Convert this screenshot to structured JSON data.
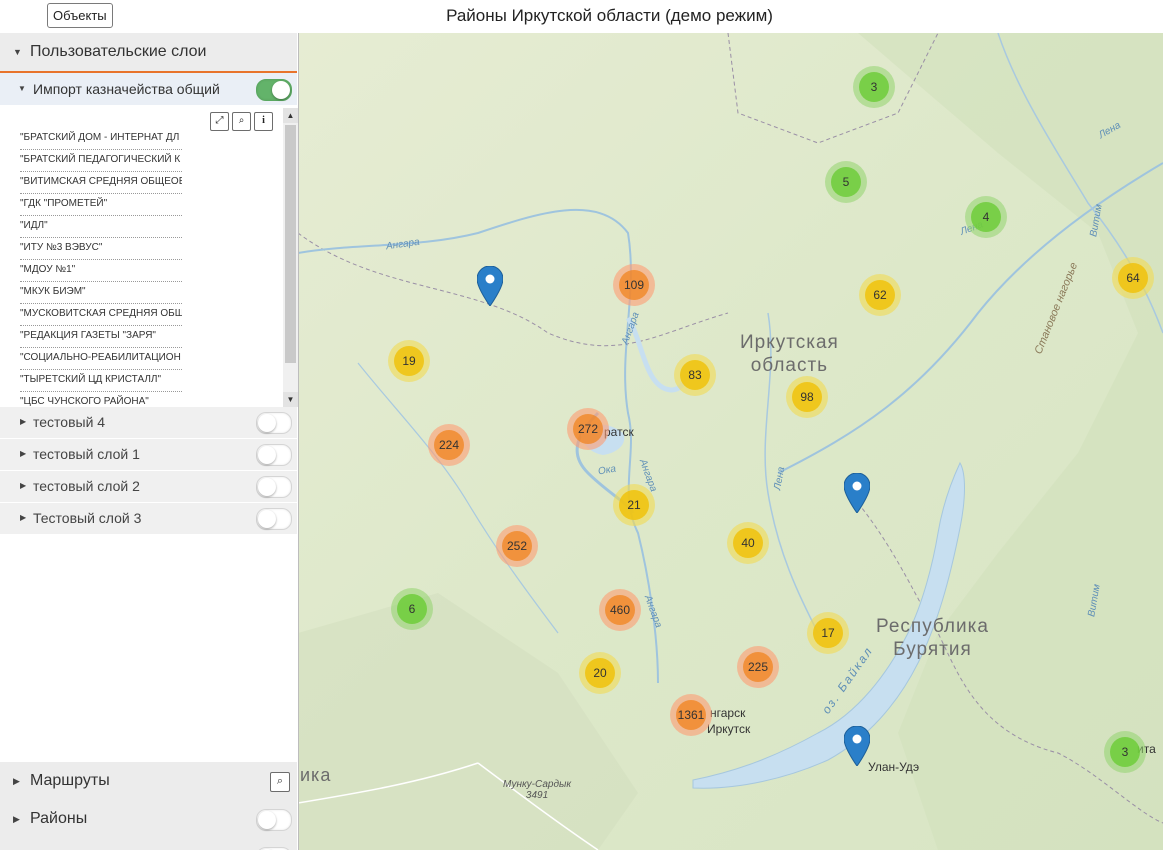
{
  "header": {
    "objects_button": "Объекты",
    "title": "Районы Иркутской области (демо режим)"
  },
  "sidebar": {
    "user_layers_title": "Пользовательские слои",
    "import_layer": {
      "label": "Импорт казначейства общий",
      "enabled": true
    },
    "toolbar": {
      "expand_icon": "expand-icon",
      "search_icon": "search-icon",
      "info_icon": "info-icon"
    },
    "objects": [
      "\"БРАТСКИЙ ДОМ - ИНТЕРНАТ ДЛ",
      "\"БРАТСКИЙ ПЕДАГОГИЧЕСКИЙ К",
      "\"ВИТИМСКАЯ СРЕДНЯЯ ОБЩЕОБ",
      "\"ГДК \"ПРОМЕТЕЙ\"",
      "\"ИДЛ\"",
      "\"ИТУ №3 ВЭВУС\"",
      "\"МДОУ №1\"",
      "\"МКУК БИЭМ\"",
      "\"МУСКОВИТСКАЯ СРЕДНЯЯ ОБЩ",
      "\"РЕДАКЦИЯ ГАЗЕТЫ \"ЗАРЯ\"",
      "\"СОЦИАЛЬНО-РЕАБИЛИТАЦИОН",
      "\"ТЫРЕТСКИЙ ЦД КРИСТАЛЛ\"",
      "\"ЦБС ЧУНСКОГО РАЙОНА\""
    ],
    "layers": [
      {
        "label": "тестовый 4",
        "enabled": false
      },
      {
        "label": "тестовый слой 1",
        "enabled": false
      },
      {
        "label": "тестовый слой 2",
        "enabled": false
      },
      {
        "label": "Тестовый слой 3",
        "enabled": false
      }
    ],
    "routes_title": "Маршруты",
    "districts_title": "Районы"
  },
  "map": {
    "colors": {
      "green": "#6ecc39",
      "yellow": "#f0c20c",
      "orange": "#f18017",
      "marker": "#2a7fc9",
      "water": "#c7dff0"
    },
    "clusters": [
      {
        "count": "3",
        "color": "green"
      },
      {
        "count": "5",
        "color": "green"
      },
      {
        "count": "4",
        "color": "green"
      },
      {
        "count": "64",
        "color": "yellow"
      },
      {
        "count": "62",
        "color": "yellow"
      },
      {
        "count": "109",
        "color": "orange"
      },
      {
        "count": "19",
        "color": "yellow"
      },
      {
        "count": "83",
        "color": "yellow"
      },
      {
        "count": "98",
        "color": "yellow"
      },
      {
        "count": "272",
        "color": "orange"
      },
      {
        "count": "224",
        "color": "orange"
      },
      {
        "count": "21",
        "color": "yellow"
      },
      {
        "count": "252",
        "color": "orange"
      },
      {
        "count": "40",
        "color": "yellow"
      },
      {
        "count": "6",
        "color": "green"
      },
      {
        "count": "460",
        "color": "orange"
      },
      {
        "count": "17",
        "color": "yellow"
      },
      {
        "count": "20",
        "color": "yellow"
      },
      {
        "count": "225",
        "color": "orange"
      },
      {
        "count": "1361",
        "color": "orange"
      },
      {
        "count": "3",
        "color": "green"
      }
    ],
    "labels": {
      "region_irkutsk": "Иркутская\nобласть",
      "region_buryatia": "Республика\nБурятия",
      "city_irkutsk": "Иркутск",
      "city_ulan_ude": "Улан-Удэ",
      "city_angarsk": "нгарск",
      "city_bratsk": "ратск",
      "city_chita": "ита",
      "edge_mongolia": "ика",
      "peak": "Мунку-Сардык\n3491",
      "river_angara_1": "Ангара",
      "river_angara_2": "Ангара",
      "river_angara_3": "Ангара",
      "river_angara_4": "Ангара",
      "river_lena_1": "Лена",
      "river_lena_2": "Лена",
      "river_lena_3": "Лена",
      "river_vitim_1": "Витим",
      "river_vitim_2": "Витим",
      "river_oka": "Ока",
      "lake_baikal": "оз. Байкал",
      "highlands": "Становое нагорье"
    }
  }
}
